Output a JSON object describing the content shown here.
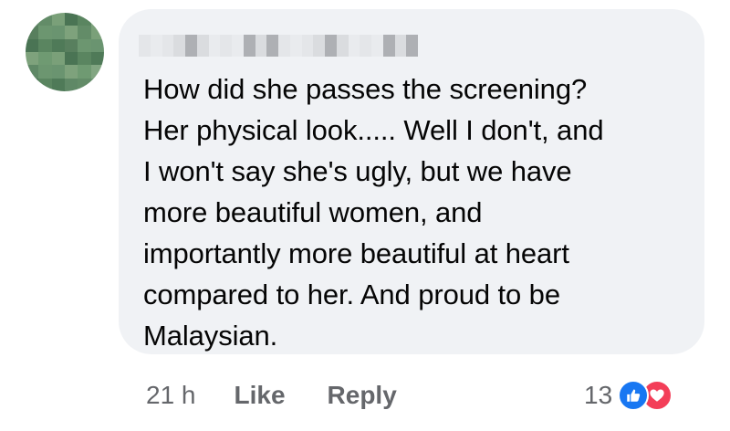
{
  "comment": {
    "author_name": "",
    "text_lines": [
      "How did she passes the screening?",
      "Her physical look..... Well I don't, and",
      "I won't say she's ugly, but we have",
      "more beautiful women, and",
      "importantly more beautiful at heart",
      "compared to her. And proud to be",
      "Malaysian."
    ]
  },
  "actions": {
    "timestamp": "21 h",
    "like_label": "Like",
    "reply_label": "Reply"
  },
  "reactions": {
    "count": "13",
    "icons": [
      "like-icon",
      "love-icon"
    ]
  },
  "colors": {
    "bubble_bg": "#f0f2f5",
    "text": "#050505",
    "secondary_text": "#65676b",
    "like_blue": "#1877f2",
    "love_red": "#f33e58"
  }
}
